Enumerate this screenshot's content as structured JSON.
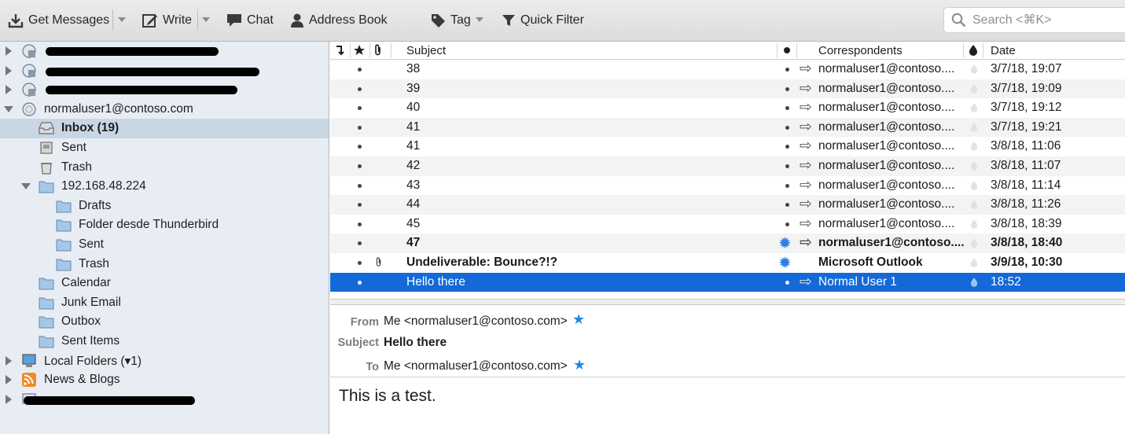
{
  "toolbar": {
    "get_messages": "Get Messages",
    "write": "Write",
    "chat": "Chat",
    "address_book": "Address Book",
    "tag": "Tag",
    "quick_filter": "Quick Filter",
    "search_placeholder": "Search <⌘K>"
  },
  "folders": {
    "account_primary": "normaluser1@contoso.com",
    "inbox": "Inbox (19)",
    "sent": "Sent",
    "trash": "Trash",
    "imap_server": "192.168.48.224",
    "drafts": "Drafts",
    "folder_desde": "Folder desde Thunderbird",
    "sub_sent": "Sent",
    "sub_trash": "Trash",
    "calendar": "Calendar",
    "junk": "Junk Email",
    "outbox": "Outbox",
    "sent_items": "Sent Items",
    "local_folders": "Local Folders (▾1)",
    "news_blogs": "News & Blogs"
  },
  "columns": {
    "subject": "Subject",
    "correspondents": "Correspondents",
    "date": "Date"
  },
  "messages": [
    {
      "subject": "38",
      "from": "normaluser1@contoso....",
      "date": "3/7/18, 19:07"
    },
    {
      "subject": "39",
      "from": "normaluser1@contoso....",
      "date": "3/7/18, 19:09"
    },
    {
      "subject": "40",
      "from": "normaluser1@contoso....",
      "date": "3/7/18, 19:12"
    },
    {
      "subject": "41",
      "from": "normaluser1@contoso....",
      "date": "3/7/18, 19:21"
    },
    {
      "subject": "41",
      "from": "normaluser1@contoso....",
      "date": "3/8/18, 11:06"
    },
    {
      "subject": "42",
      "from": "normaluser1@contoso....",
      "date": "3/8/18, 11:07"
    },
    {
      "subject": "43",
      "from": "normaluser1@contoso....",
      "date": "3/8/18, 11:14"
    },
    {
      "subject": "44",
      "from": "normaluser1@contoso....",
      "date": "3/8/18, 11:26"
    },
    {
      "subject": "45",
      "from": "normaluser1@contoso....",
      "date": "3/8/18, 18:39"
    },
    {
      "subject": "47",
      "from": "normaluser1@contoso....",
      "date": "3/8/18, 18:40"
    },
    {
      "subject": "Undeliverable: Bounce?!?",
      "from": "Microsoft Outlook",
      "date": "3/9/18, 10:30"
    },
    {
      "subject": "Hello there",
      "from": "Normal User 1",
      "date": "18:52"
    }
  ],
  "message_header": {
    "from_label": "From",
    "from_value": "Me <normaluser1@contoso.com>",
    "subject_label": "Subject",
    "subject_value": "Hello there",
    "to_label": "To",
    "to_value": "Me <normaluser1@contoso.com>"
  },
  "message_body": "This is a test.",
  "colors": {
    "selection": "#1469d8",
    "folder_selected": "#c9d6e3",
    "folder_pane": "#e8edf3",
    "unread_star": "#1f8ae6"
  }
}
